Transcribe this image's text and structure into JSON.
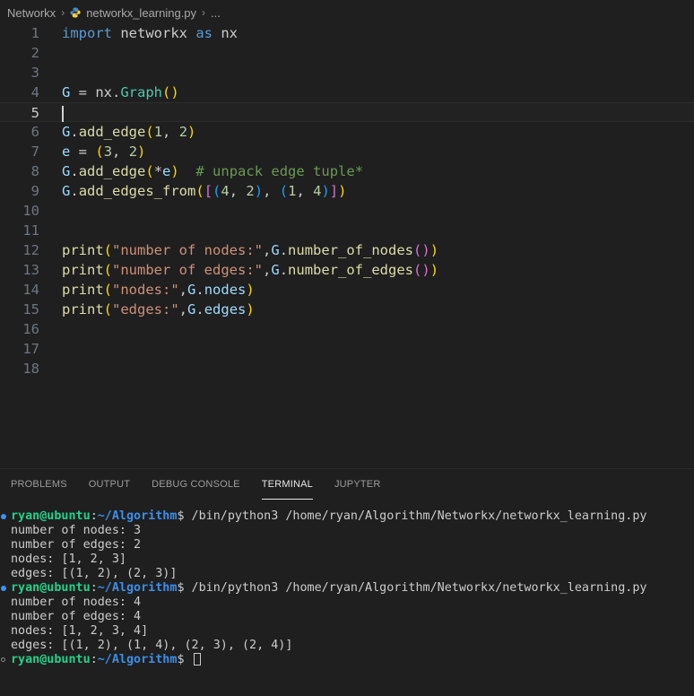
{
  "breadcrumb": {
    "folder": "Networkx",
    "file": "networkx_learning.py",
    "more": "..."
  },
  "editor": {
    "line_numbers": [
      "1",
      "2",
      "3",
      "4",
      "5",
      "6",
      "7",
      "8",
      "9",
      "10",
      "11",
      "12",
      "13",
      "14",
      "15",
      "16",
      "17",
      "18"
    ],
    "current_line": 5,
    "lines": [
      [
        {
          "t": "import",
          "c": "kw"
        },
        {
          "t": " networkx "
        },
        {
          "t": "as",
          "c": "kw"
        },
        {
          "t": " nx"
        }
      ],
      [],
      [],
      [
        {
          "t": "G",
          "c": "var"
        },
        {
          "t": " = nx."
        },
        {
          "t": "Graph",
          "c": "cls"
        },
        {
          "t": "()",
          "c": "b1"
        }
      ],
      [],
      [
        {
          "t": "G",
          "c": "var"
        },
        {
          "t": "."
        },
        {
          "t": "add_edge",
          "c": "fn"
        },
        {
          "t": "(",
          "c": "b1"
        },
        {
          "t": "1",
          "c": "num"
        },
        {
          "t": ", "
        },
        {
          "t": "2",
          "c": "num"
        },
        {
          "t": ")",
          "c": "b1"
        }
      ],
      [
        {
          "t": "e",
          "c": "var"
        },
        {
          "t": " = "
        },
        {
          "t": "(",
          "c": "b1"
        },
        {
          "t": "3",
          "c": "num"
        },
        {
          "t": ", "
        },
        {
          "t": "2",
          "c": "num"
        },
        {
          "t": ")",
          "c": "b1"
        }
      ],
      [
        {
          "t": "G",
          "c": "var"
        },
        {
          "t": "."
        },
        {
          "t": "add_edge",
          "c": "fn"
        },
        {
          "t": "(",
          "c": "b1"
        },
        {
          "t": "*"
        },
        {
          "t": "e",
          "c": "var"
        },
        {
          "t": ")",
          "c": "b1"
        },
        {
          "t": "  "
        },
        {
          "t": "# unpack edge tuple*",
          "c": "com"
        }
      ],
      [
        {
          "t": "G",
          "c": "var"
        },
        {
          "t": "."
        },
        {
          "t": "add_edges_from",
          "c": "fn"
        },
        {
          "t": "(",
          "c": "b1"
        },
        {
          "t": "[",
          "c": "b2"
        },
        {
          "t": "(",
          "c": "b3"
        },
        {
          "t": "4",
          "c": "num"
        },
        {
          "t": ", "
        },
        {
          "t": "2",
          "c": "num"
        },
        {
          "t": ")",
          "c": "b3"
        },
        {
          "t": ", "
        },
        {
          "t": "(",
          "c": "b3"
        },
        {
          "t": "1",
          "c": "num"
        },
        {
          "t": ", "
        },
        {
          "t": "4",
          "c": "num"
        },
        {
          "t": ")",
          "c": "b3"
        },
        {
          "t": "]",
          "c": "b2"
        },
        {
          "t": ")",
          "c": "b1"
        }
      ],
      [],
      [],
      [
        {
          "t": "print",
          "c": "fn"
        },
        {
          "t": "(",
          "c": "b1"
        },
        {
          "t": "\"number of nodes:\"",
          "c": "str"
        },
        {
          "t": ","
        },
        {
          "t": "G",
          "c": "var"
        },
        {
          "t": "."
        },
        {
          "t": "number_of_nodes",
          "c": "fn"
        },
        {
          "t": "(",
          "c": "b2"
        },
        {
          "t": ")",
          "c": "b2"
        },
        {
          "t": ")",
          "c": "b1"
        }
      ],
      [
        {
          "t": "print",
          "c": "fn"
        },
        {
          "t": "(",
          "c": "b1"
        },
        {
          "t": "\"number of edges:\"",
          "c": "str"
        },
        {
          "t": ","
        },
        {
          "t": "G",
          "c": "var"
        },
        {
          "t": "."
        },
        {
          "t": "number_of_edges",
          "c": "fn"
        },
        {
          "t": "(",
          "c": "b2"
        },
        {
          "t": ")",
          "c": "b2"
        },
        {
          "t": ")",
          "c": "b1"
        }
      ],
      [
        {
          "t": "print",
          "c": "fn"
        },
        {
          "t": "(",
          "c": "b1"
        },
        {
          "t": "\"nodes:\"",
          "c": "str"
        },
        {
          "t": ","
        },
        {
          "t": "G",
          "c": "var"
        },
        {
          "t": "."
        },
        {
          "t": "nodes",
          "c": "var"
        },
        {
          "t": ")",
          "c": "b1"
        }
      ],
      [
        {
          "t": "print",
          "c": "fn"
        },
        {
          "t": "(",
          "c": "b1"
        },
        {
          "t": "\"edges:\"",
          "c": "str"
        },
        {
          "t": ","
        },
        {
          "t": "G",
          "c": "var"
        },
        {
          "t": "."
        },
        {
          "t": "edges",
          "c": "var"
        },
        {
          "t": ")",
          "c": "b1"
        }
      ],
      [],
      [],
      []
    ]
  },
  "panel": {
    "tabs": [
      "PROBLEMS",
      "OUTPUT",
      "DEBUG CONSOLE",
      "TERMINAL",
      "JUPYTER"
    ],
    "active_tab": "TERMINAL"
  },
  "terminal": {
    "lines": [
      {
        "kind": "prompt",
        "user": "ryan@ubuntu",
        "path": "~/Algorithm",
        "cmd": "$ /bin/python3 /home/ryan/Algorithm/Networkx/networkx_learning.py",
        "dot": "filled"
      },
      {
        "kind": "out",
        "text": "number of nodes: 3"
      },
      {
        "kind": "out",
        "text": "number of edges: 2"
      },
      {
        "kind": "out",
        "text": "nodes: [1, 2, 3]"
      },
      {
        "kind": "out",
        "text": "edges: [(1, 2), (2, 3)]"
      },
      {
        "kind": "prompt",
        "user": "ryan@ubuntu",
        "path": "~/Algorithm",
        "cmd": "$ /bin/python3 /home/ryan/Algorithm/Networkx/networkx_learning.py",
        "dot": "filled"
      },
      {
        "kind": "out",
        "text": "number of nodes: 4"
      },
      {
        "kind": "out",
        "text": "number of edges: 4"
      },
      {
        "kind": "out",
        "text": "nodes: [1, 2, 3, 4]"
      },
      {
        "kind": "out",
        "text": "edges: [(1, 2), (1, 4), (2, 3), (2, 4)]"
      },
      {
        "kind": "prompt",
        "user": "ryan@ubuntu",
        "path": "~/Algorithm",
        "cmd": "$ ",
        "dot": "hollow",
        "cursor": true
      }
    ]
  },
  "colors": {
    "background": "#1f1f1f",
    "prompt_user": "#23d18b",
    "prompt_path": "#3b8eea",
    "dot": "#3794ff"
  }
}
